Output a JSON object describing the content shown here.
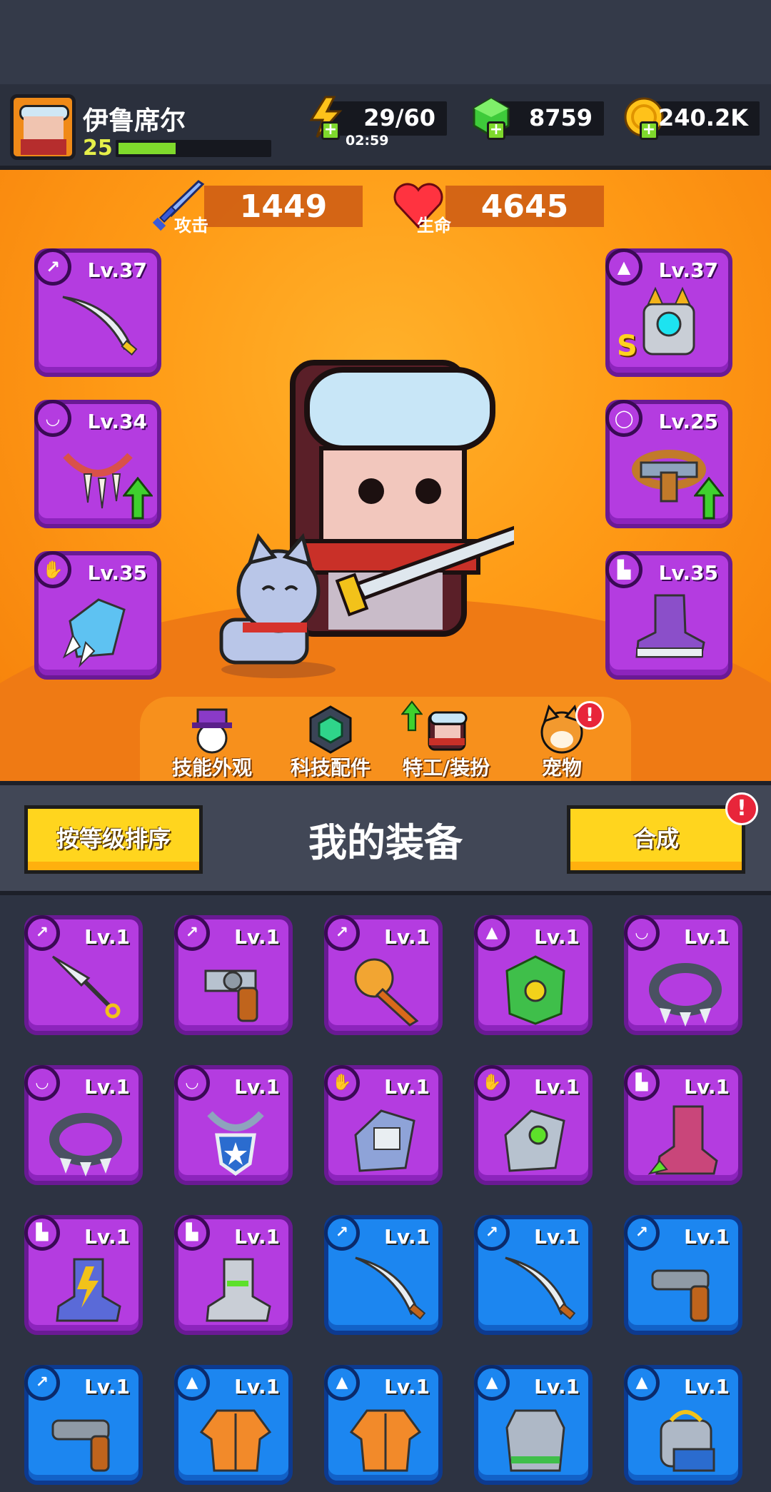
{
  "player": {
    "name": "伊鲁席尔",
    "level": "25",
    "xp_fraction": 0.38
  },
  "resources": {
    "energy": "29/60",
    "energy_timer": "02:59",
    "gems": "8759",
    "coins": "240.2K"
  },
  "stats": {
    "attack_value": "1449",
    "attack_label": "攻击",
    "hp_value": "4645",
    "hp_label": "生命"
  },
  "equipped": [
    {
      "slot": "weapon",
      "level": "Lv.37",
      "icon": "sword-icon",
      "upgrade": false
    },
    {
      "slot": "armor",
      "level": "Lv.37",
      "icon": "mech-armor-icon",
      "upgrade": false,
      "rank": "S"
    },
    {
      "slot": "necklace",
      "level": "Lv.34",
      "icon": "fang-necklace-icon",
      "upgrade": true
    },
    {
      "slot": "belt",
      "level": "Lv.25",
      "icon": "belt-icon",
      "upgrade": true
    },
    {
      "slot": "gloves",
      "level": "Lv.35",
      "icon": "claw-glove-icon",
      "upgrade": false
    },
    {
      "slot": "boots",
      "level": "Lv.35",
      "icon": "sneaker-icon",
      "upgrade": false
    }
  ],
  "tabs": [
    {
      "label": "技能外观",
      "icon": "hat-ball-icon",
      "alert": false
    },
    {
      "label": "科技配件",
      "icon": "hex-chip-icon",
      "alert": false
    },
    {
      "label": "特工/装扮",
      "icon": "agent-head-icon",
      "alert": false,
      "upgrade": true
    },
    {
      "label": "宠物",
      "icon": "dog-face-icon",
      "alert": true
    }
  ],
  "equipment_bar": {
    "sort_label": "按等级排序",
    "title": "我的装备",
    "merge_label": "合成",
    "alert": "!"
  },
  "inventory": [
    {
      "level": "Lv.1",
      "rarity": "purple",
      "slot": "weapon",
      "icon": "kunai-icon"
    },
    {
      "level": "Lv.1",
      "rarity": "purple",
      "slot": "weapon",
      "icon": "revolver-icon"
    },
    {
      "level": "Lv.1",
      "rarity": "purple",
      "slot": "weapon",
      "icon": "torch-icon"
    },
    {
      "level": "Lv.1",
      "rarity": "purple",
      "slot": "armor",
      "icon": "leaf-armor-icon"
    },
    {
      "level": "Lv.1",
      "rarity": "purple",
      "slot": "necklace",
      "icon": "spike-collar-icon"
    },
    {
      "level": "Lv.1",
      "rarity": "purple",
      "slot": "necklace",
      "icon": "spike-collar-icon"
    },
    {
      "level": "Lv.1",
      "rarity": "purple",
      "slot": "necklace",
      "icon": "star-medal-icon"
    },
    {
      "level": "Lv.1",
      "rarity": "purple",
      "slot": "gloves",
      "icon": "mech-glove-icon"
    },
    {
      "level": "Lv.1",
      "rarity": "purple",
      "slot": "gloves",
      "icon": "green-gear-glove-icon"
    },
    {
      "level": "Lv.1",
      "rarity": "purple",
      "slot": "boots",
      "icon": "spike-boot-icon"
    },
    {
      "level": "Lv.1",
      "rarity": "purple",
      "slot": "boots",
      "icon": "lightning-boot-icon"
    },
    {
      "level": "Lv.1",
      "rarity": "purple",
      "slot": "boots",
      "icon": "green-sneaker-icon"
    },
    {
      "level": "Lv.1",
      "rarity": "blue",
      "slot": "weapon",
      "icon": "katana-icon"
    },
    {
      "level": "Lv.1",
      "rarity": "blue",
      "slot": "weapon",
      "icon": "katana-icon"
    },
    {
      "level": "Lv.1",
      "rarity": "blue",
      "slot": "weapon",
      "icon": "pistol-icon"
    },
    {
      "level": "Lv.1",
      "rarity": "blue",
      "slot": "weapon",
      "icon": "pistol-icon"
    },
    {
      "level": "Lv.1",
      "rarity": "blue",
      "slot": "armor",
      "icon": "orange-jacket-icon"
    },
    {
      "level": "Lv.1",
      "rarity": "blue",
      "slot": "armor",
      "icon": "orange-jacket-icon"
    },
    {
      "level": "Lv.1",
      "rarity": "blue",
      "slot": "armor",
      "icon": "steel-vest-icon"
    },
    {
      "level": "Lv.1",
      "rarity": "blue",
      "slot": "armor",
      "icon": "robot-armor-icon"
    }
  ],
  "colors": {
    "purple": "#b43ce0",
    "blue": "#1c86f0",
    "accent_yellow": "#ffd51e",
    "stage_orange": "#ff9b16"
  }
}
